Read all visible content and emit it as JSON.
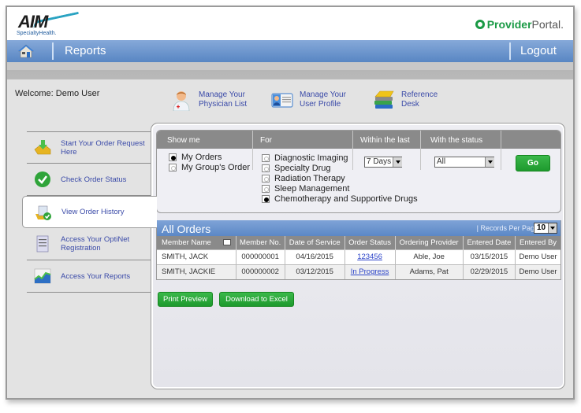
{
  "header": {
    "logo_text": "AIM",
    "logo_sub": "SpecialtyHealth.",
    "portal_bold": "Provider",
    "portal_light": "Portal."
  },
  "navbar": {
    "home_icon": "home-icon",
    "title": "Reports",
    "logout": "Logout"
  },
  "welcome": "Welcome: Demo User",
  "quick_links": [
    {
      "label1": "Manage Your",
      "label2": "Physician List",
      "icon": "physician-icon"
    },
    {
      "label1": "Manage Your",
      "label2": "User Profile",
      "icon": "profile-card-icon"
    },
    {
      "label1": "Reference",
      "label2": "Desk",
      "icon": "books-icon"
    }
  ],
  "sidebar": {
    "items": [
      {
        "label": "Start Your Order Request Here",
        "icon": "inbox-download-icon"
      },
      {
        "label": "Check Order Status",
        "icon": "checkmark-icon"
      },
      {
        "label": "View Order History",
        "icon": "order-history-icon",
        "active": true
      },
      {
        "label": "Access Your OptiNet Registration",
        "icon": "document-icon"
      },
      {
        "label": "Access Your Reports",
        "icon": "chart-icon"
      }
    ]
  },
  "filter": {
    "show_me_label": "Show me",
    "for_label": "For",
    "within_label": "Within the last",
    "status_label": "With the status",
    "show_me_options": [
      {
        "label": "My Orders",
        "selected": true
      },
      {
        "label": "My Group's Order",
        "selected": false
      }
    ],
    "for_options": [
      {
        "label": "Diagnostic Imaging",
        "selected": false
      },
      {
        "label": "Specialty Drug",
        "selected": false
      },
      {
        "label": "Radiation Therapy",
        "selected": false
      },
      {
        "label": "Sleep Management",
        "selected": false
      },
      {
        "label": "Chemotherapy and Supportive Drugs",
        "selected": true
      }
    ],
    "within_value": "7 Days",
    "status_value": "All",
    "go_label": "Go"
  },
  "orders": {
    "title": "All Orders",
    "records_per_page_label": "| Records Per Page",
    "records_per_page_value": "10",
    "columns": [
      "Member Name",
      "Member No.",
      "Date of Service",
      "Order Status",
      "Ordering Provider",
      "Entered Date",
      "Entered By"
    ],
    "rows": [
      [
        "SMITH, JACK",
        "000000001",
        "04/16/2015",
        "123456",
        "Able, Joe",
        "03/15/2015",
        "Demo User"
      ],
      [
        "SMITH, JACKIE",
        "000000002",
        "03/12/2015",
        "In Progress",
        "Adams, Pat",
        "02/29/2015",
        "Demo User"
      ]
    ]
  },
  "actions": {
    "print_preview": "Print Preview",
    "download_excel": "Download to Excel"
  },
  "colors": {
    "nav_blue": "#5886c3",
    "link_blue": "#3a4aa8",
    "green_button": "#1e9a2e",
    "header_gray": "#8a8a8a"
  }
}
